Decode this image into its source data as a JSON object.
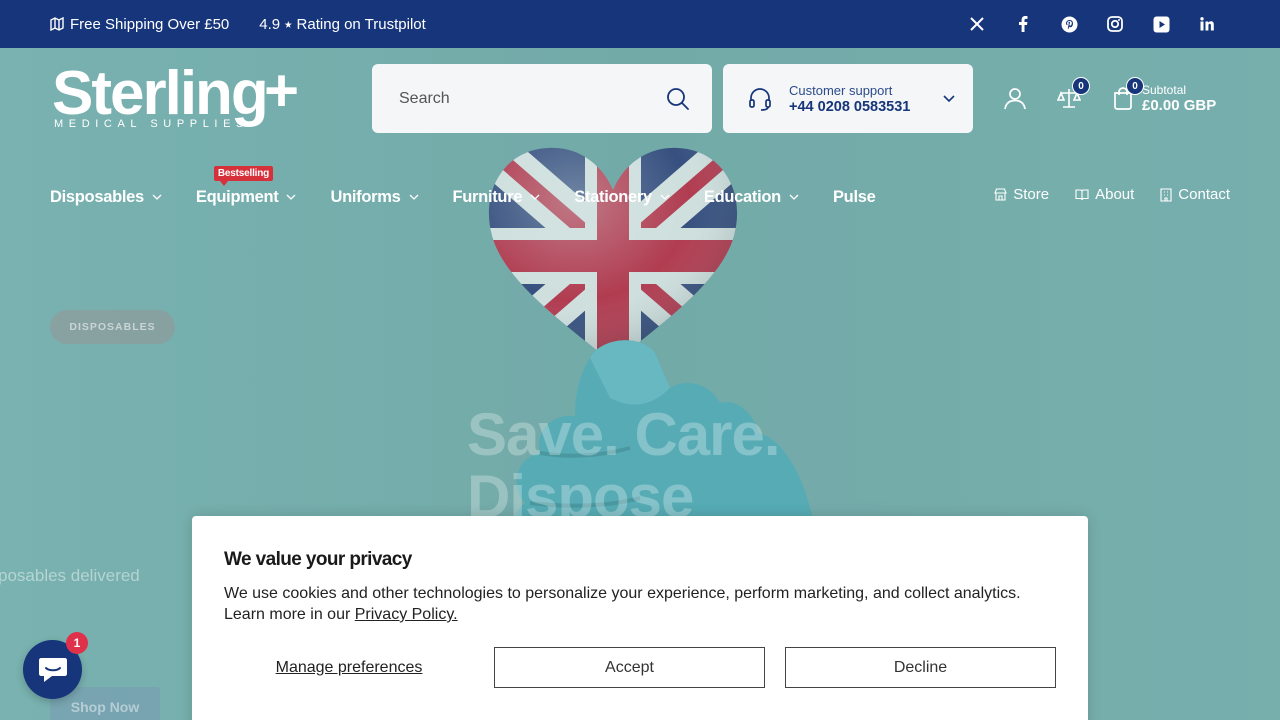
{
  "announcement": {
    "shipping": "Free Shipping Over £50",
    "rating": "4.9 ⭑ Rating on Trustpilot",
    "social": [
      "x-icon",
      "facebook-icon",
      "pinterest-icon",
      "instagram-icon",
      "youtube-icon",
      "linkedin-icon"
    ]
  },
  "logo": {
    "name": "Sterling",
    "plus": "+",
    "tagline": "MEDICAL SUPPLIES"
  },
  "search": {
    "placeholder": "Search"
  },
  "support": {
    "label": "Customer support",
    "phone": "+44 0208 0583531"
  },
  "header": {
    "compare_count": "0",
    "cart_count": "0",
    "subtotal_label": "Subtotal",
    "subtotal_value": "£0.00 GBP"
  },
  "nav": {
    "items": [
      {
        "label": "Disposables"
      },
      {
        "label": "Equipment",
        "badge": "Bestselling"
      },
      {
        "label": "Uniforms"
      },
      {
        "label": "Furniture"
      },
      {
        "label": "Stationery"
      },
      {
        "label": "Education"
      },
      {
        "label": "Pulse"
      }
    ],
    "right": [
      {
        "label": "Store"
      },
      {
        "label": "About"
      },
      {
        "label": "Contact"
      }
    ]
  },
  "hero": {
    "tag": "DISPOSABLES",
    "headline_1": "Save. Care.",
    "headline_2": "Dispose",
    "subline": "posables delivered",
    "cta": "Shop Now"
  },
  "chat": {
    "unread": "1"
  },
  "cookie": {
    "title": "We value your privacy",
    "text": "We use cookies and other technologies to personalize your experience, perform marketing, and collect analytics. Learn more in our ",
    "link": "Privacy Policy.",
    "manage": "Manage preferences",
    "accept": "Accept",
    "decline": "Decline"
  },
  "colors": {
    "brand_navy": "#16357a",
    "badge_red": "#d6313b",
    "hero_teal": "#74abaa"
  }
}
